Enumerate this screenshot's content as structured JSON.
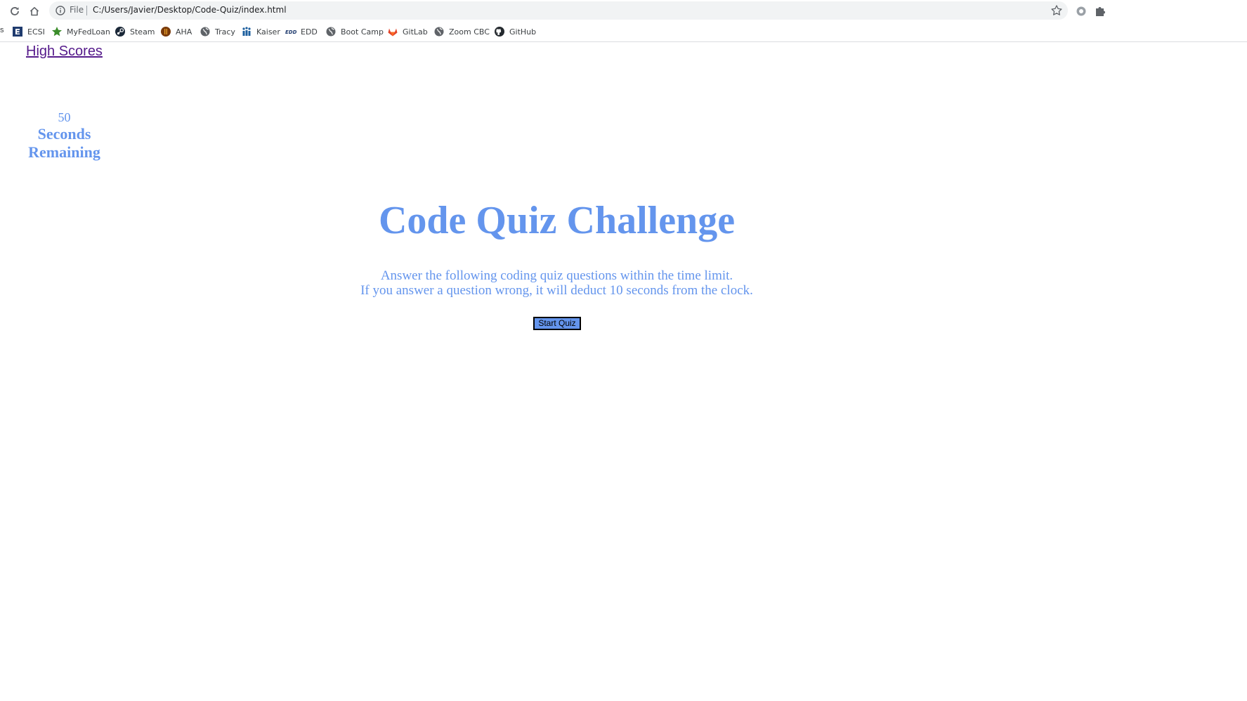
{
  "browser": {
    "url_scheme": "File",
    "url": "C:/Users/Javier/Desktop/Code-Quiz/index.html",
    "bookmarks_overflow": "s",
    "bookmarks": [
      {
        "label": "ECSI",
        "icon": "ecsi-icon"
      },
      {
        "label": "MyFedLoan",
        "icon": "star-logo-icon"
      },
      {
        "label": "Steam",
        "icon": "steam-icon"
      },
      {
        "label": "AHA",
        "icon": "aha-icon"
      },
      {
        "label": "Tracy",
        "icon": "globe-icon"
      },
      {
        "label": "Kaiser",
        "icon": "kaiser-icon"
      },
      {
        "label": "EDD",
        "icon": "edd-icon"
      },
      {
        "label": "Boot Camp",
        "icon": "globe-icon"
      },
      {
        "label": "GitLab",
        "icon": "gitlab-icon"
      },
      {
        "label": "Zoom CBC",
        "icon": "globe-icon"
      },
      {
        "label": "GitHub",
        "icon": "github-icon"
      }
    ]
  },
  "page": {
    "high_scores_link": "High Scores",
    "timer": {
      "count": "50",
      "label": "Seconds Remaining"
    },
    "title": "Code Quiz Challenge",
    "description_line1": "Answer the following coding quiz questions within the time limit.",
    "description_line2": "If you answer a question wrong, it will deduct 10 seconds from the clock.",
    "start_button": "Start Quiz"
  },
  "colors": {
    "accent": "#6495ed",
    "visited_link": "#551a8b"
  }
}
